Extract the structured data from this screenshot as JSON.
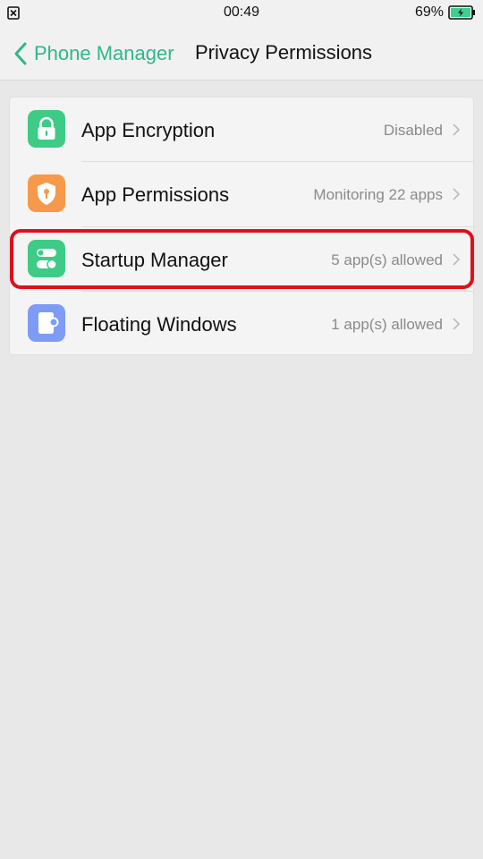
{
  "status_bar": {
    "time": "00:49",
    "battery_percent": "69%",
    "battery_color": "#3fcf8e"
  },
  "header": {
    "back_label": "Phone Manager",
    "title": "Privacy Permissions",
    "accent_color": "#2bb98a"
  },
  "items": [
    {
      "label": "App Encryption",
      "value": "Disabled",
      "icon": "lock-icon",
      "icon_color": "#3dcb86"
    },
    {
      "label": "App Permissions",
      "value": "Monitoring 22 apps",
      "icon": "shield-key-icon",
      "icon_color": "#f7994a"
    },
    {
      "label": "Startup Manager",
      "value": "5 app(s) allowed",
      "icon": "toggle-switch-icon",
      "icon_color": "#3dcb86"
    },
    {
      "label": "Floating Windows",
      "value": "1 app(s) allowed",
      "icon": "floating-window-icon",
      "icon_color": "#7e9bf6"
    }
  ],
  "highlighted_item": "Startup Manager"
}
